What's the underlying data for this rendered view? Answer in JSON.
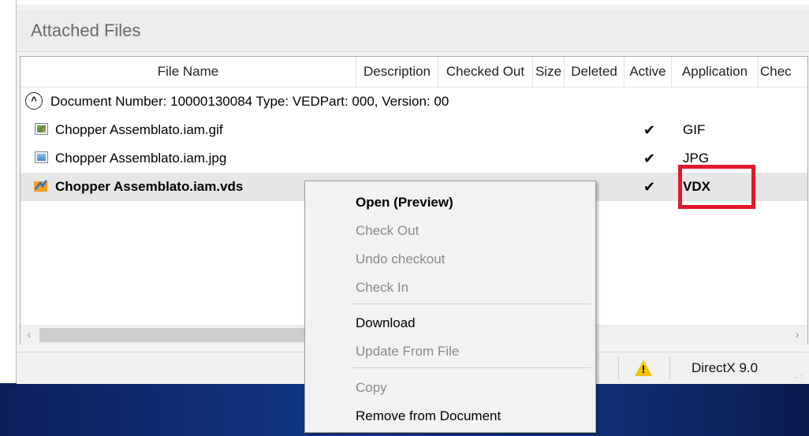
{
  "panel": {
    "title": "Attached Files"
  },
  "columns": [
    "File Name",
    "Description",
    "Checked Out",
    "Size",
    "Deleted",
    "Active",
    "Application",
    "Chec"
  ],
  "group": {
    "expander_symbol": "^",
    "text": "Document Number: 10000130084 Type: VEDPart: 000, Version: 00"
  },
  "files": [
    {
      "name": "Chopper Assemblato.iam.gif",
      "icon": "gif-image-icon",
      "active": "✔",
      "application": "GIF"
    },
    {
      "name": "Chopper Assemblato.iam.jpg",
      "icon": "jpg-image-icon",
      "active": "✔",
      "application": "JPG"
    },
    {
      "name": "Chopper Assemblato.iam.vds",
      "icon": "vds-file-icon",
      "active": "✔",
      "application": "VDX",
      "selected": true
    }
  ],
  "scrollbar": {
    "left_arrow": "‹",
    "right_arrow": "›"
  },
  "status": {
    "warning_symbol": "!",
    "text": "DirectX 9.0"
  },
  "context_menu": {
    "items": [
      {
        "label": "Open (Preview)",
        "state": "default"
      },
      {
        "label": "Check Out",
        "state": "disabled"
      },
      {
        "label": "Undo checkout",
        "state": "disabled"
      },
      {
        "label": "Check In",
        "state": "disabled"
      },
      {
        "label": "Download",
        "state": "enabled"
      },
      {
        "label": "Update From File",
        "state": "disabled"
      },
      {
        "label": "Copy",
        "state": "disabled"
      },
      {
        "label": "Remove from Document",
        "state": "enabled"
      }
    ]
  },
  "colors": {
    "highlight": "#e0192b",
    "selected_row": "#e6e6e6",
    "desktop": "#123a8a",
    "warning": "#f2c200"
  }
}
